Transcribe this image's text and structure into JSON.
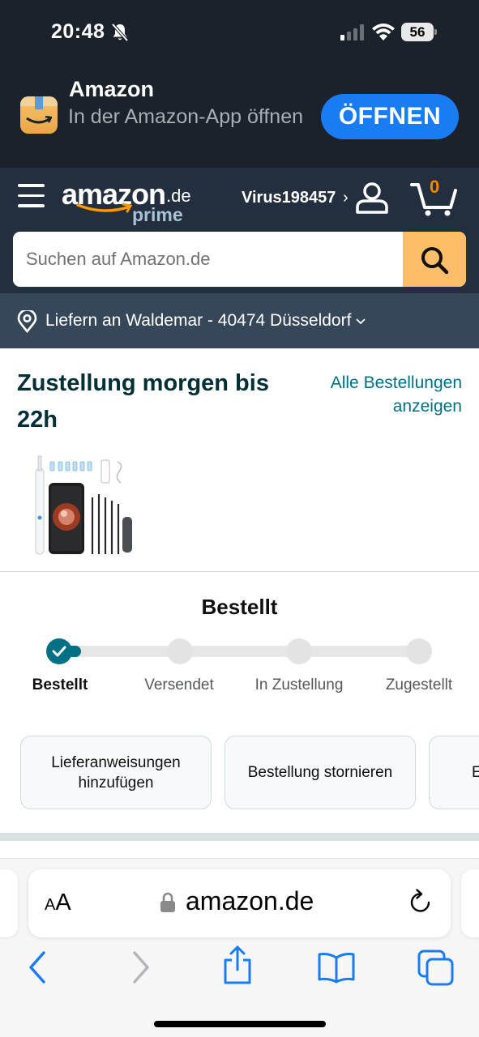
{
  "status_bar": {
    "time": "20:48",
    "battery": "56"
  },
  "app_banner": {
    "app_name": "Amazon",
    "subtitle": "In der Amazon-App öffnen",
    "open_label": "ÖFFNEN"
  },
  "header": {
    "logo_word": "amazon",
    "logo_tld": ".de",
    "logo_prime": "prime",
    "account_name": "Virus198457",
    "account_chevron": "›",
    "cart_count": "0",
    "search_placeholder": "Suchen auf Amazon.de",
    "deliver_to": "Liefern an Waldemar - 40474 Düsseldorf"
  },
  "order": {
    "delivery_title": "Zustellung morgen bis 22h",
    "all_orders_link": "Alle Bestellungen anzeigen",
    "status_title": "Bestellt",
    "progress": 0,
    "steps": [
      {
        "label": "Bestellt",
        "done": true
      },
      {
        "label": "Versendet",
        "done": false
      },
      {
        "label": "In Zustellung",
        "done": false
      },
      {
        "label": "Zugestellt",
        "done": false
      }
    ],
    "actions": [
      {
        "label": "Lieferanweisungen hinzufügen"
      },
      {
        "label": "Bestellung stornieren"
      },
      {
        "label": "E"
      }
    ]
  },
  "browser": {
    "text_size_label_small": "A",
    "text_size_label_large": "A",
    "url": "amazon.de",
    "toolbar_icons": [
      "back-icon",
      "forward-icon",
      "share-icon",
      "bookmarks-icon",
      "tabs-icon"
    ]
  },
  "colors": {
    "banner_bg": "#1b222b",
    "header_bg": "#232f3e",
    "deliver_bg": "#37475a",
    "search_button": "#febd69",
    "open_button": "#1a7cf2",
    "teal": "#007185",
    "cart_orange": "#f08804",
    "ios_blue": "#1a7cf2"
  }
}
